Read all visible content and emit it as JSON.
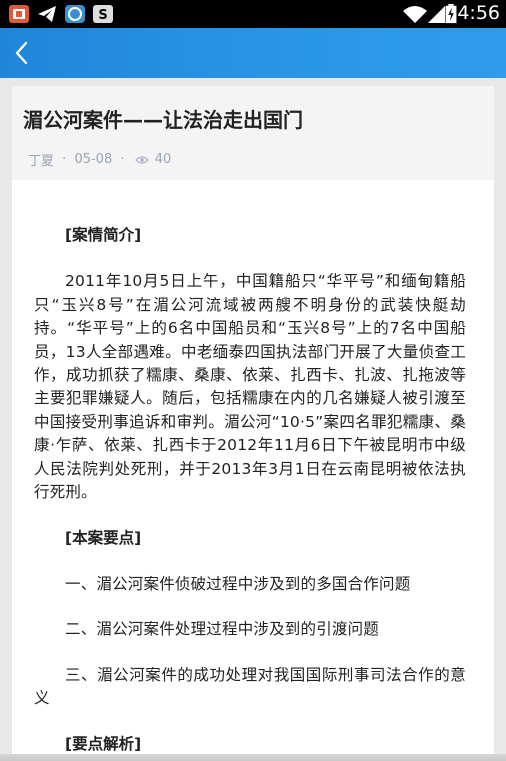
{
  "status_bar": {
    "time": "4:56",
    "icons": [
      "app-notification-icon",
      "telegram-icon",
      "app-notification-icon-2",
      "s-app-icon",
      "wifi-icon",
      "signal-icon",
      "battery-icon"
    ]
  },
  "article": {
    "title": "湄公河案件——让法治走出国门",
    "author": "丁夏",
    "separator": "·",
    "date": "05-08",
    "views": "40",
    "sections": {
      "intro_head": "[案情简介]",
      "intro_body": "2011年10月5日上午，中国籍船只“华平号”和缅甸籍船只“玉兴8号”在湄公河流域被两艘不明身份的武装快艇劫持。“华平号”上的6名中国船员和“玉兴8号”上的7名中国船员，13人全部遇难。中老缅泰四国执法部门开展了大量侦查工作，成功抓获了糯康、桑康、依莱、扎西卡、扎波、扎拖波等主要犯罪嫌疑人。随后，包括糯康在内的几名嫌疑人被引渡至中国接受刑事追诉和审判。湄公河“10·5”案四名罪犯糯康、桑康·乍萨、依莱、扎西卡于2012年11月6日下午被昆明市中级人民法院判处死刑，并于2013年3月1日在云南昆明被依法执行死刑。",
      "points_head": "[本案要点]",
      "point_1": "一、湄公河案件侦破过程中涉及到的多国合作问题",
      "point_2": "二、湄公河案件处理过程中涉及到的引渡问题",
      "point_3": "三、湄公河案件的成功处理对我国国际刑事司法合作的意义",
      "analysis_head": "[要点解析]"
    }
  },
  "colors": {
    "appbar": "#2a96e6",
    "meta_text": "#9aa5b3",
    "header_bg": "#f4f4f4"
  }
}
